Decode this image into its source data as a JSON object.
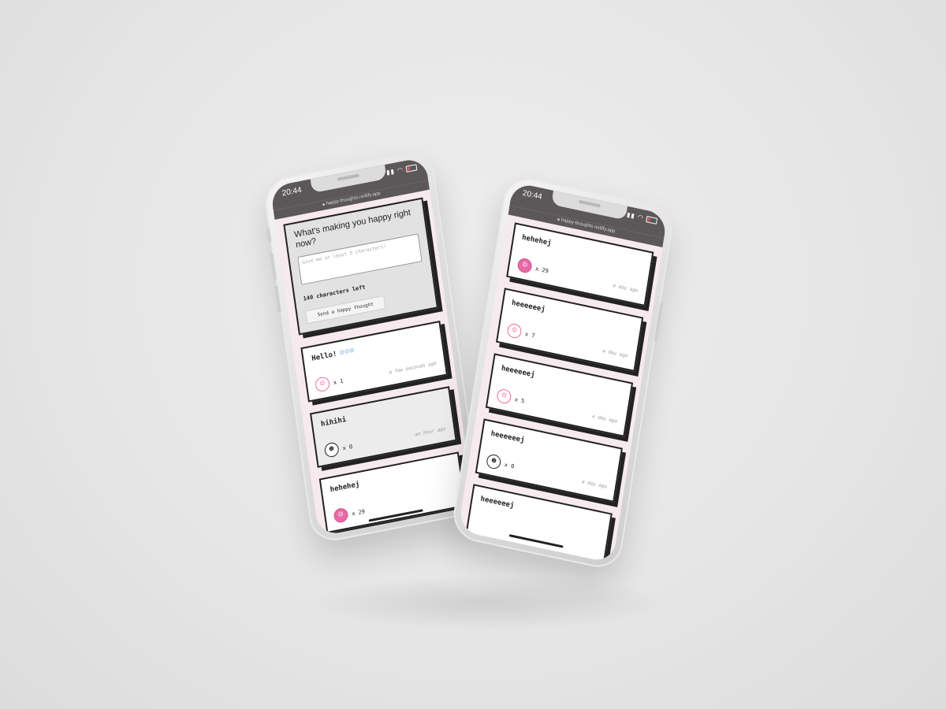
{
  "phone_left": {
    "time": "20:44",
    "url": "happy-thoughts.netlify.app",
    "form": {
      "title": "What's making you happy right now?",
      "placeholder": "Give me at least 5 characters!",
      "chars_left": "140 characters left",
      "send_label": "Send a happy thought"
    },
    "thoughts": [
      {
        "message": "Hello!",
        "emoji": "☺☺☺",
        "icon": "heart-icon",
        "count": "x 1",
        "time": "a few seconds ago"
      },
      {
        "message": "hihihi",
        "icon": "heart-icon",
        "count": "x 0",
        "time": "an hour ago"
      },
      {
        "message": "hehehej",
        "icon": "heart-icon",
        "count": "x 29",
        "time": ""
      }
    ]
  },
  "phone_right": {
    "time": "20:44",
    "url": "happy-thoughts.netlify.app",
    "thoughts": [
      {
        "message": "hehehej",
        "icon": "heart-icon",
        "count": "x 29",
        "time": "a day ago"
      },
      {
        "message": "heeeeeej",
        "icon": "heart-icon",
        "count": "x 7",
        "time": "a day ago"
      },
      {
        "message": "heeeeeej",
        "icon": "heart-icon",
        "count": "x 5",
        "time": "a day ago"
      },
      {
        "message": "heeeeeej",
        "icon": "heart-icon",
        "count": "x 0",
        "time": "a day ago"
      },
      {
        "message": "heeeeeej",
        "icon": "heart-icon",
        "count": "",
        "time": ""
      }
    ]
  },
  "colors": {
    "background": "#e6e6e6",
    "status_bar": "#5c5859",
    "screen_bg": "#f7eaee",
    "accent_pink": "#ef6aa0",
    "card_border": "#222222"
  }
}
